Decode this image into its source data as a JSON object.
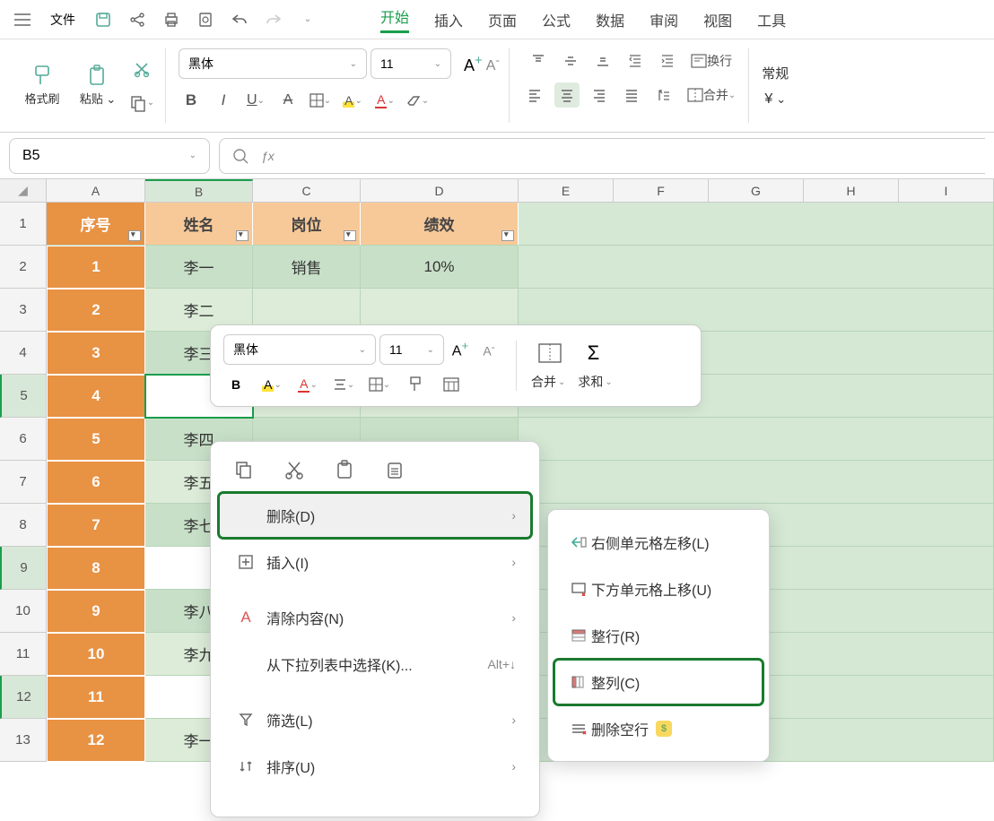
{
  "topbar": {
    "file_label": "文件",
    "tabs": [
      "开始",
      "插入",
      "页面",
      "公式",
      "数据",
      "审阅",
      "视图",
      "工具"
    ]
  },
  "ribbon": {
    "format_painter": "格式刷",
    "paste": "粘贴",
    "font_name": "黑体",
    "font_size": "11",
    "wrap": "换行",
    "merge": "合并",
    "number_format": "常规"
  },
  "cellref": "B5",
  "columns": [
    "A",
    "B",
    "C",
    "D",
    "E",
    "F",
    "G",
    "H",
    "I"
  ],
  "rows": [
    "1",
    "2",
    "3",
    "4",
    "5",
    "6",
    "7",
    "8",
    "9",
    "10",
    "11",
    "12",
    "13"
  ],
  "table": {
    "headers": [
      "序号",
      "姓名",
      "岗位",
      "绩效"
    ],
    "rows": [
      [
        "1",
        "李一",
        "销售",
        "10%"
      ],
      [
        "2",
        "李二",
        "",
        ""
      ],
      [
        "3",
        "李三",
        "",
        ""
      ],
      [
        "4",
        "",
        "",
        ""
      ],
      [
        "5",
        "李四",
        "",
        ""
      ],
      [
        "6",
        "李五",
        "",
        ""
      ],
      [
        "7",
        "李七",
        "",
        ""
      ],
      [
        "8",
        "",
        "",
        ""
      ],
      [
        "9",
        "李八",
        "",
        ""
      ],
      [
        "10",
        "李九",
        "",
        ""
      ],
      [
        "11",
        "",
        "",
        ""
      ],
      [
        "12",
        "李一",
        "",
        ""
      ]
    ]
  },
  "minibar": {
    "font_name": "黑体",
    "font_size": "11",
    "merge": "合并",
    "sum": "求和"
  },
  "context_menu": {
    "delete": "删除(D)",
    "insert": "插入(I)",
    "clear": "清除内容(N)",
    "dropdown": "从下拉列表中选择(K)...",
    "dropdown_shortcut": "Alt+↓",
    "filter": "筛选(L)",
    "sort": "排序(U)"
  },
  "submenu": {
    "left": "右侧单元格左移(L)",
    "up": "下方单元格上移(U)",
    "row": "整行(R)",
    "col": "整列(C)",
    "blank": "删除空行"
  }
}
